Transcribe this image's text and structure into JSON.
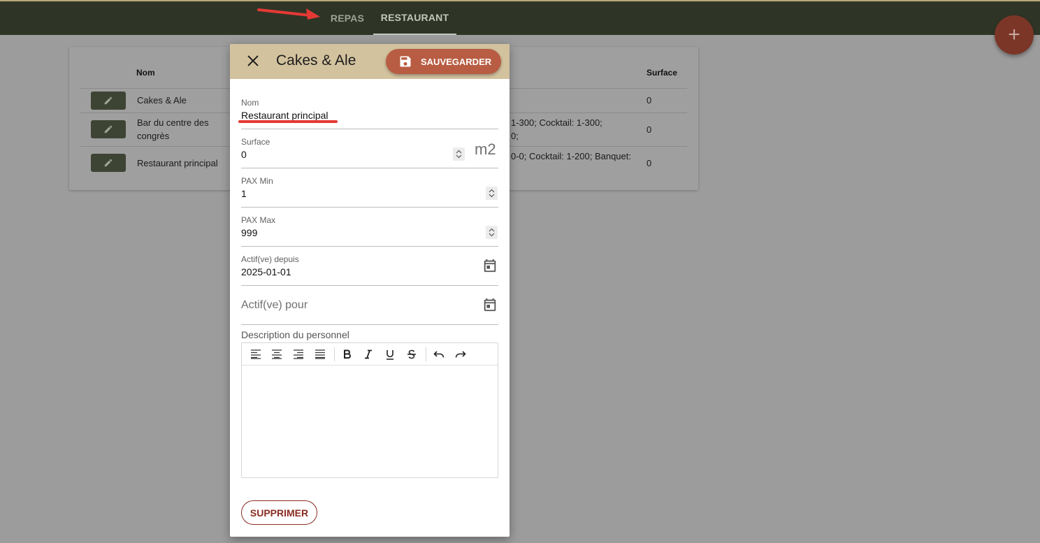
{
  "nav": {
    "tabs": [
      {
        "label": "REPAS"
      },
      {
        "label": "RESTAURANT"
      }
    ],
    "fab_symbol": "+"
  },
  "table": {
    "headers": {
      "name": "Nom",
      "surface": "Surface"
    },
    "rows": [
      {
        "name": "Cakes & Ale",
        "pax": "",
        "surface": "0"
      },
      {
        "name": "Bar du centre des congrès",
        "pax_line1": "1-300; Cocktail: 1-300;",
        "pax_line2": "0;",
        "surface": "0"
      },
      {
        "name": "Restaurant principal",
        "pax_line1": "0-0; Cocktail: 1-200; Banquet:",
        "surface": "0"
      }
    ]
  },
  "dialog": {
    "title": "Cakes & Ale",
    "save_label": "SAUVEGARDER",
    "fields": {
      "nom": {
        "label": "Nom",
        "value": "Restaurant principal"
      },
      "surface": {
        "label": "Surface",
        "value": "0",
        "unit": "m2"
      },
      "pax_min": {
        "label": "PAX Min",
        "value": "1"
      },
      "pax_max": {
        "label": "PAX Max",
        "value": "999"
      },
      "actif_depuis": {
        "label": "Actif(ve) depuis",
        "value": "2025-01-01"
      },
      "actif_pour": {
        "placeholder": "Actif(ve) pour"
      }
    },
    "description_label": "Description du personnel",
    "delete_label": "SUPPRIMER"
  },
  "colors": {
    "topbar": "#2f3526",
    "header": "#d3c29e",
    "save_button": "#b85d43",
    "delete": "#8b2b22",
    "annotation_red": "#e53935"
  }
}
